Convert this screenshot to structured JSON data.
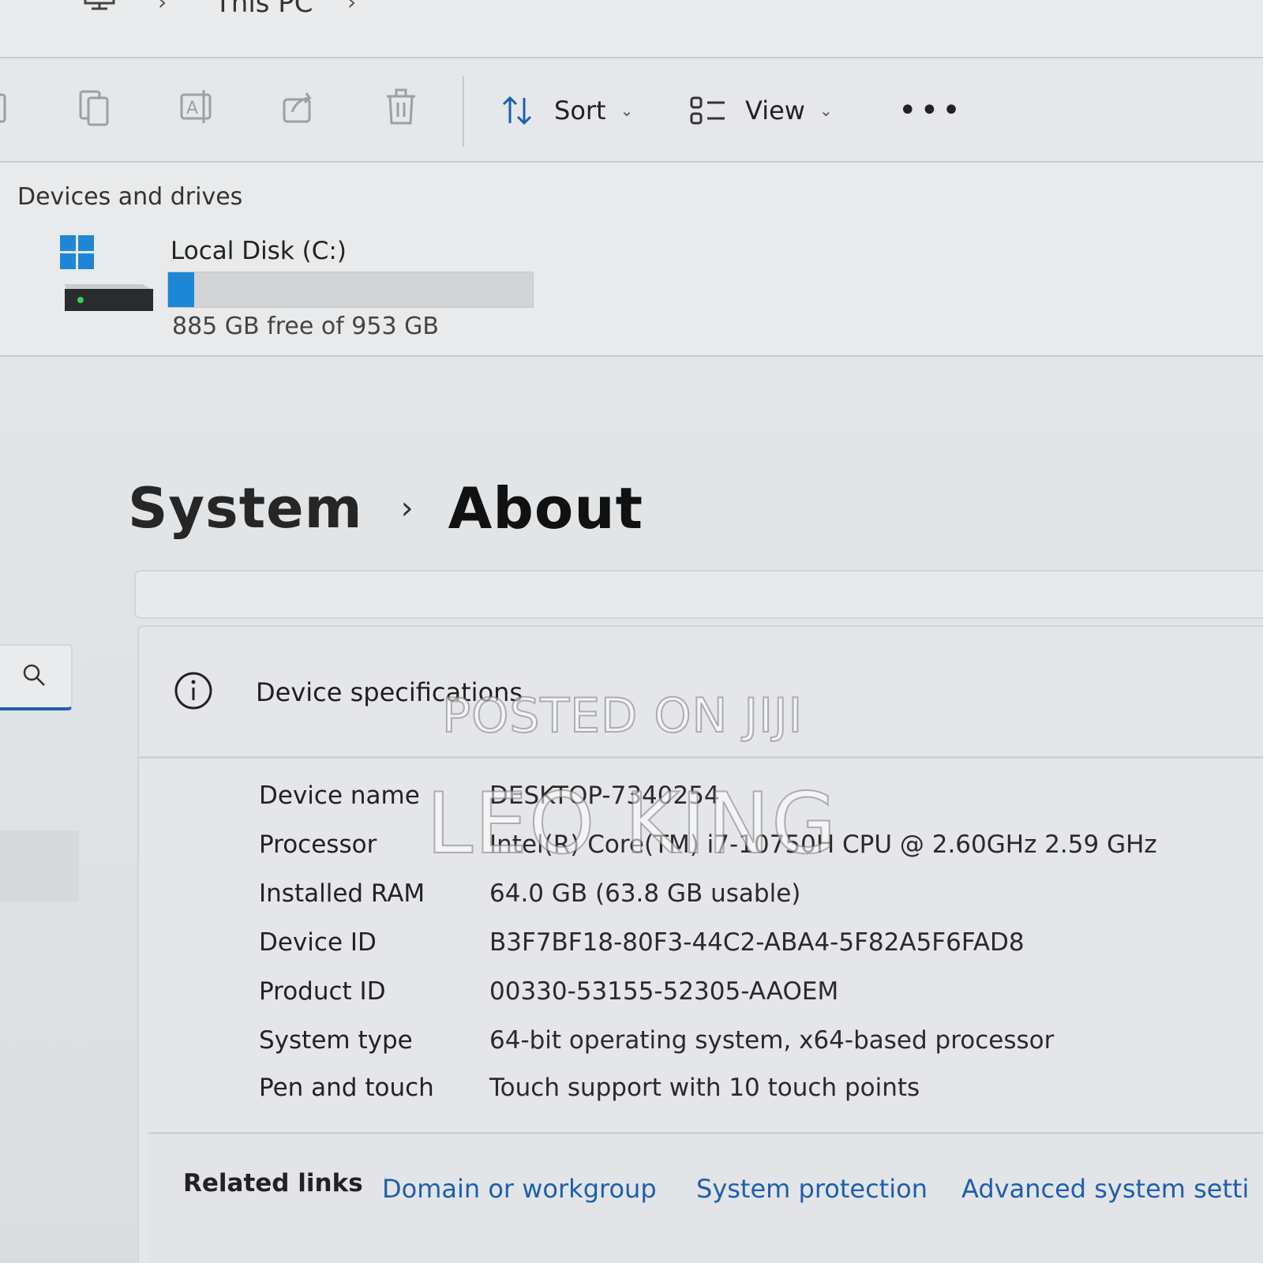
{
  "addressbar": {
    "crumbs": [
      "This PC"
    ],
    "pc_icon": "computer-icon"
  },
  "toolbar": {
    "icons": [
      "copy-icon",
      "rename-icon",
      "share-icon",
      "delete-icon"
    ],
    "sort_label": "Sort",
    "view_label": "View",
    "more_label": "•••"
  },
  "drives": {
    "section_title": "Devices and drives",
    "items": [
      {
        "name": "Local Disk (C:)",
        "usage": 0.071,
        "free_text": "885 GB free of 953 GB",
        "bar_color": "#1c87d6"
      }
    ]
  },
  "settings": {
    "breadcrumb_parent": "System",
    "breadcrumb_current": "About",
    "spec_section_title": "Device specifications",
    "specs": [
      {
        "label": "Device name",
        "value": "DESKTOP-7340254"
      },
      {
        "label": "Processor",
        "value": "Intel(R) Core(TM) i7-10750H CPU @ 2.60GHz   2.59 GHz"
      },
      {
        "label": "Installed RAM",
        "value": "64.0 GB (63.8 GB usable)"
      },
      {
        "label": "Device ID",
        "value": "B3F7BF18-80F3-44C2-ABA4-5F82A5F6FAD8"
      },
      {
        "label": "Product ID",
        "value": "00330-53155-52305-AAOEM"
      },
      {
        "label": "System type",
        "value": "64-bit operating system, x64-based processor"
      },
      {
        "label": "Pen and touch",
        "value": "Touch support with 10 touch points"
      }
    ],
    "related_title": "Related links",
    "related_links": [
      "Domain or workgroup",
      "System protection",
      "Advanced system setti"
    ]
  },
  "watermark": {
    "line1": "POSTED ON JIJI",
    "line2": "LEO KING"
  },
  "colors": {
    "accent": "#1d5fb0",
    "link": "#1e5fae",
    "drive_bar": "#1c87d6"
  }
}
